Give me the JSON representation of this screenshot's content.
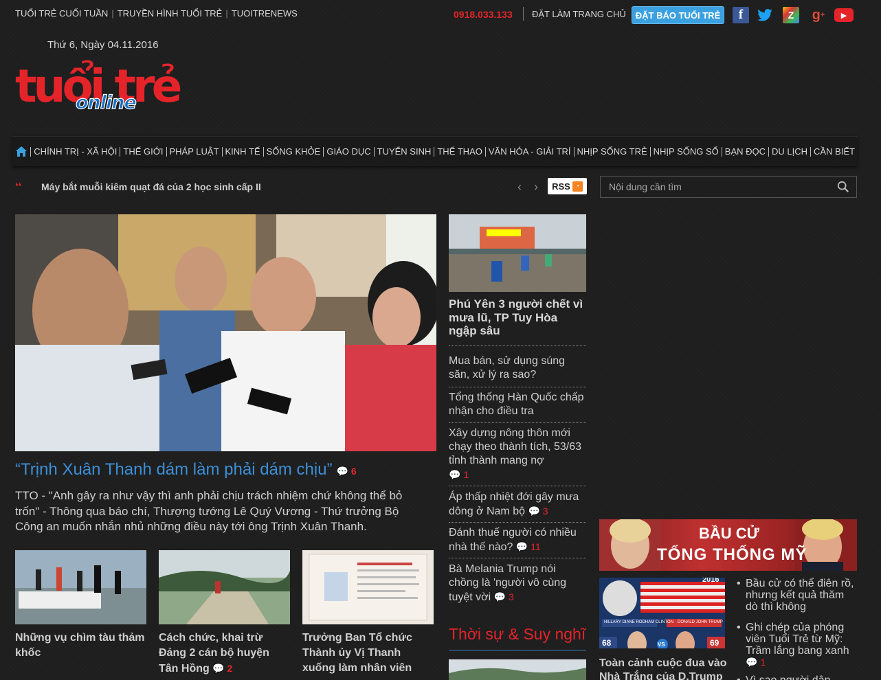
{
  "topbar": {
    "links": [
      "TUỔI TRẺ CUỐI TUẦN",
      "TRUYỀN HÌNH TUỔI TRẺ",
      "TUOITRENEWS"
    ],
    "hotline": "0918.033.133",
    "homepage": "ĐẶT LÀM TRANG CHỦ",
    "subscribe": "ĐẶT BÁO TUỔI TRẺ",
    "social_icons": [
      "facebook-icon",
      "twitter-icon",
      "zing-icon",
      "google-plus-icon",
      "youtube-icon"
    ]
  },
  "header": {
    "date": "Thứ 6, Ngày 04.11.2016",
    "logo_main": "tuổi trẻ",
    "logo_sub": "online"
  },
  "nav": {
    "items": [
      "CHÍNH TRỊ - XÃ HỘI",
      "THẾ GIỚI",
      "PHÁP LUẬT",
      "KINH TẾ",
      "SỐNG KHỎE",
      "GIÁO DỤC",
      "TUYỂN SINH",
      "THỂ THAO",
      "VĂN HÓA - GIẢI TRÍ",
      "NHỊP SỐNG TRẺ",
      "NHỊP SỐNG SỐ",
      "BẠN ĐỌC",
      "DU LỊCH",
      "CẦN BIẾT"
    ]
  },
  "ticker": {
    "text": "Máy bắt muỗi kiêm quạt đá của 2 học sinh cấp II",
    "rss": "RSS"
  },
  "search": {
    "placeholder": "Nội dung cần tìm"
  },
  "main": {
    "headline": "“Trịnh Xuân Thanh dám làm phải dám chịu”",
    "comments": "6",
    "lead": "TTO - \"Anh gây ra như vậy thì anh phải chịu trách nhiệm chứ không thể bỏ trốn\" - Thông qua báo chí, Thượng tướng Lê Quý Vương - Thứ trưởng Bộ Công an muốn nhắn nhủ những điều này tới ông Trịnh Xuân Thanh.",
    "thumbs": [
      {
        "title": "Những vụ chìm tàu thảm khốc",
        "comments": ""
      },
      {
        "title": "Cách chức, khai trừ Đảng 2 cán bộ huyện Tân Hồng",
        "comments": "2"
      },
      {
        "title": "Trưởng Ban Tổ chức Thành ủy Vị Thanh xuống làm nhân viên",
        "comments": ""
      }
    ]
  },
  "mid": {
    "lead_title": "Phú Yên 3 người chết vì mưa lũ, TP Tuy Hòa ngập sâu",
    "items": [
      {
        "title": "Mua bán, sử dụng súng săn, xử lý ra sao?",
        "comments": ""
      },
      {
        "title": "Tổng thống Hàn Quốc chấp nhận cho điều tra",
        "comments": ""
      },
      {
        "title": "Xây dựng nông thôn mới chạy theo thành tích, 53/63 tỉnh thành mang nợ",
        "comments": "1"
      },
      {
        "title": "Áp thấp nhiệt đới gây mưa dông ở Nam bộ",
        "comments": "3"
      },
      {
        "title": "Đánh thuế người có nhiều nhà thế nào?",
        "comments": "11"
      },
      {
        "title": "Bà Melania Trump nói chồng là 'người vô cùng tuyệt vời",
        "comments": "3"
      }
    ],
    "section_title": "Thời sự & Suy nghĩ"
  },
  "right": {
    "banner_line1": "BẦU CỬ",
    "banner_line2": "TỔNG THỐNG MỸ",
    "elect_caption": "Toàn cảnh cuộc đua vào Nhà Trắng của D.Trump",
    "elect_year": "2016",
    "elect_score_left": "68",
    "elect_score_right": "69",
    "elect_vs": "VS",
    "elect_name_left": "HILLARY DIANE RODHAM CLINTON",
    "elect_name_right": "DONALD JOHN TRUMP",
    "list": [
      {
        "title": "Bầu cử có thể điên rồ, nhưng kết quả thăm dò thì không",
        "comments": ""
      },
      {
        "title": "Ghi chép của phóng viên Tuổi Trẻ từ Mỹ: Trầm lắng bang xanh",
        "comments": "1"
      },
      {
        "title": "Vì sao người dân",
        "comments": ""
      }
    ]
  },
  "colors": {
    "accent": "#e5242a",
    "link": "#3b8fd8",
    "subscribe": "#3aa0e0",
    "background": "#1e1e1e"
  }
}
